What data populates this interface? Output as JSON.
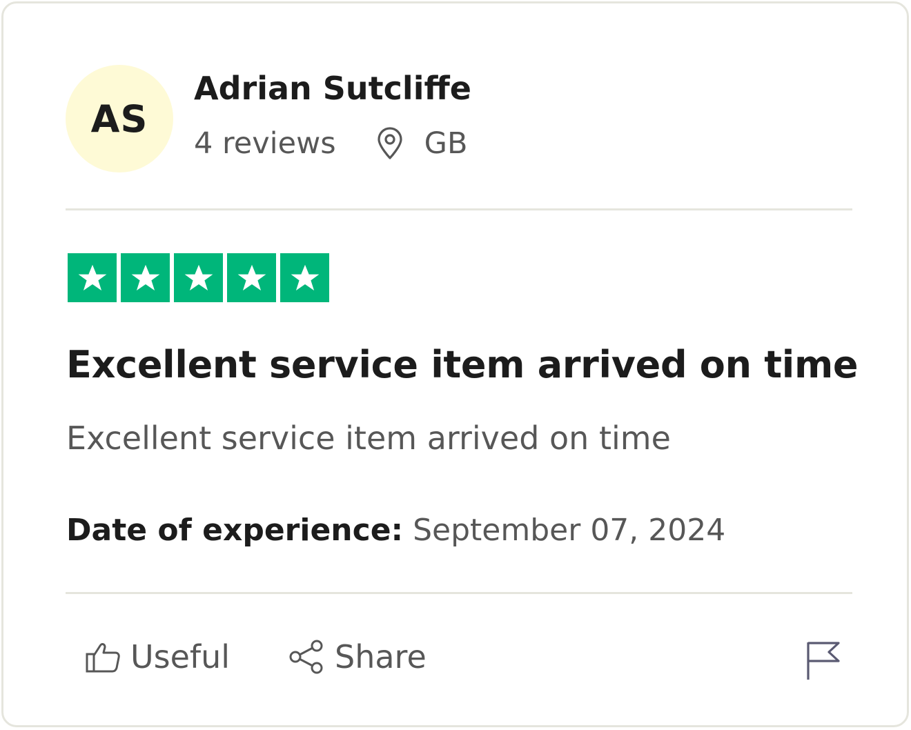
{
  "reviewer": {
    "initials": "AS",
    "name": "Adrian Sutcliffe",
    "reviews_count": "4 reviews",
    "country": "GB",
    "avatar_bg": "#fefad6"
  },
  "rating": {
    "stars": 5,
    "max_stars": 5,
    "color": "#00b67a"
  },
  "review": {
    "title": "Excellent service item arrived on time",
    "body": "Excellent service item arrived on time",
    "date_label": "Date of experience:",
    "date_value": "September 07, 2024"
  },
  "actions": {
    "useful_label": "Useful",
    "share_label": "Share",
    "flag_icon": "flag-icon"
  },
  "icons": {
    "location": "location-pin-icon",
    "useful": "thumbs-up-icon",
    "share": "share-icon"
  }
}
